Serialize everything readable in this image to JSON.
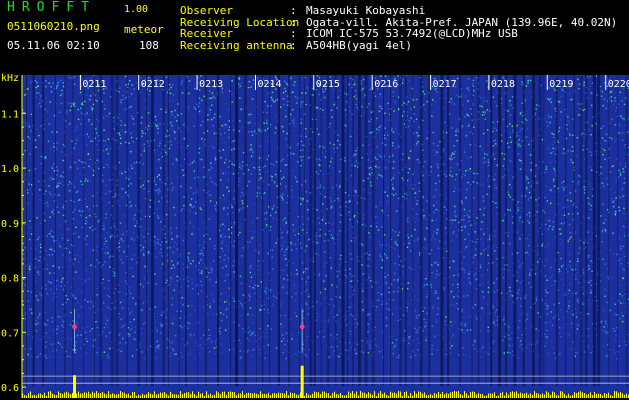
{
  "app": {
    "title": "HROFFT",
    "version": "1.00",
    "filename": "0511060210.png",
    "datetime": "05.11.06 02:10",
    "meteor_label": "meteor",
    "meteor_count": "108"
  },
  "info": {
    "rows": [
      {
        "label": "Observer",
        "value": "Masayuki Kobayashi"
      },
      {
        "label": "Receiving Location",
        "value": "Ogata-vill. Akita-Pref. JAPAN (139.96E, 40.02N)"
      },
      {
        "label": "Receiver",
        "value": "ICOM IC-575 53.7492(@LCD)MHz USB"
      },
      {
        "label": "Receiving antenna",
        "value": "A504HB(yagi 4el)"
      }
    ]
  },
  "colors": {
    "header_yellow": "#ffff00",
    "title_green": "#22dd22",
    "text_white": "#ffffff",
    "spectrum_base": "#1c2f9e",
    "spectrum_hot": "#2ee0c0",
    "signal_bar": "#ffff00"
  },
  "chart_data": {
    "type": "heatmap",
    "title": "",
    "xlabel": "",
    "ylabel": "kHz",
    "x_ticks": [
      "0211",
      "0212",
      "0213",
      "0214",
      "0215",
      "0216",
      "0217",
      "0218",
      "0219",
      "0220"
    ],
    "y_ticks": [
      "1.1",
      "1.0",
      "0.9",
      "0.8",
      "0.7",
      "0.6"
    ],
    "y_values": [
      1.1,
      1.0,
      0.9,
      0.8,
      0.7,
      0.6
    ],
    "ylim": [
      0.58,
      1.17
    ],
    "reference_lines_khz": [
      0.62,
      0.607
    ],
    "meteor_echoes": [
      {
        "time": "02:10.9",
        "khz": 0.71
      },
      {
        "time": "02:14.8",
        "khz": 0.71
      }
    ],
    "signal_spikes": [
      {
        "time": "02:10.9",
        "level": 0.6
      },
      {
        "time": "02:14.8",
        "level": 0.85
      }
    ]
  }
}
